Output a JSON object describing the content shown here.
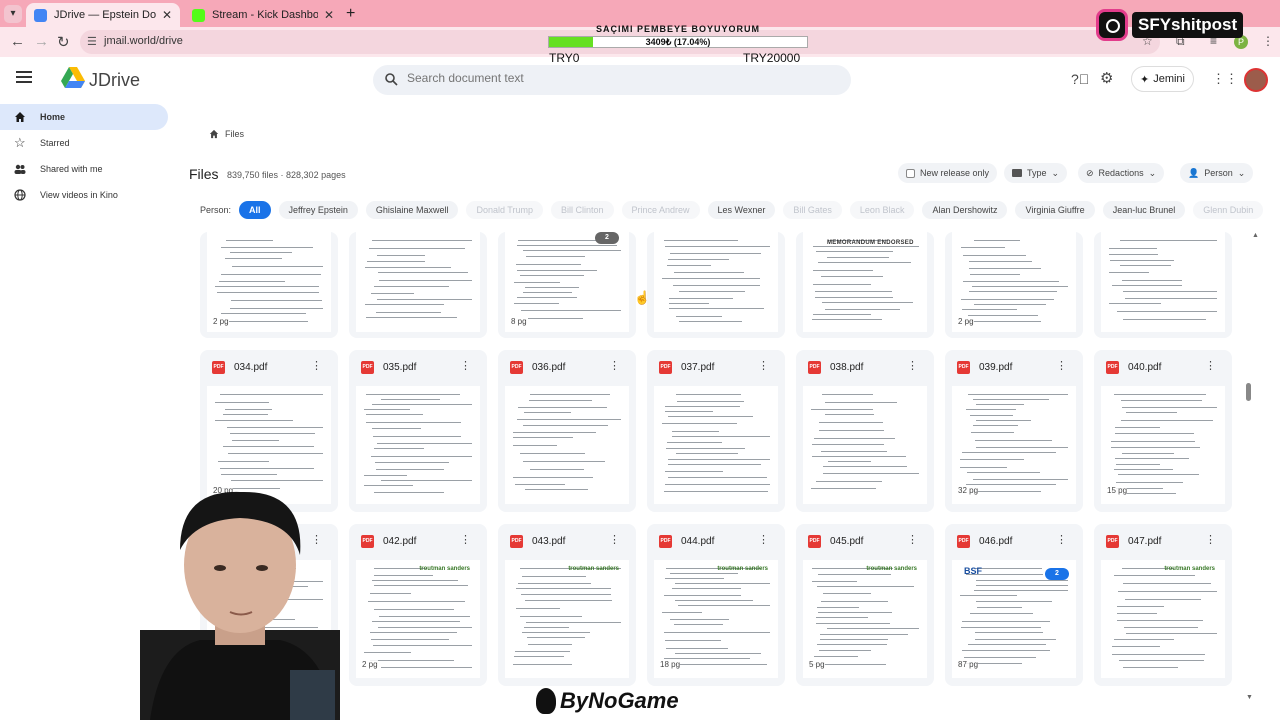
{
  "browser": {
    "tabs": [
      {
        "title": "JDrive — Epstein Document Ar",
        "active": true,
        "favicon_color": "#4285f4"
      },
      {
        "title": "Stream - Kick Dashboard",
        "active": false,
        "favicon_color": "#53fc18"
      }
    ],
    "url": "jmail.world/drive",
    "profile_initial": "P"
  },
  "overlay": {
    "goal_title": "SAÇIMI PEMBEYE BOYUYORUM",
    "goal_progress_text": "3409₺ (17.04%)",
    "goal_fraction": 0.1704,
    "goal_min": "TRY0",
    "goal_max": "TRY20000",
    "instagram_handle": "SFYshitpost",
    "watermark": "ByNoGame"
  },
  "app": {
    "name": "JDrive",
    "search_placeholder": "Search document text",
    "assistant_label": "Jemini",
    "sidebar": [
      {
        "label": "Home",
        "icon": "home-icon",
        "active": true
      },
      {
        "label": "Starred",
        "icon": "star-icon",
        "active": false
      },
      {
        "label": "Shared with me",
        "icon": "people-icon",
        "active": false
      },
      {
        "label": "View videos in Kino",
        "icon": "globe-icon",
        "active": false
      }
    ],
    "breadcrumb": "Files",
    "files_title": "Files",
    "files_meta": "839,750 files · 828,302 pages",
    "filters": {
      "new_release": "New release only",
      "type": "Type",
      "redactions": "Redactions",
      "person": "Person"
    },
    "person_label": "Person:",
    "person_chips": [
      {
        "label": "All",
        "state": "selected"
      },
      {
        "label": "Jeffrey Epstein",
        "state": "normal"
      },
      {
        "label": "Ghislaine Maxwell",
        "state": "normal"
      },
      {
        "label": "Donald Trump",
        "state": "dim"
      },
      {
        "label": "Bill Clinton",
        "state": "dim"
      },
      {
        "label": "Prince Andrew",
        "state": "dim"
      },
      {
        "label": "Les Wexner",
        "state": "normal"
      },
      {
        "label": "Bill Gates",
        "state": "dim"
      },
      {
        "label": "Leon Black",
        "state": "dim"
      },
      {
        "label": "Alan Dershowitz",
        "state": "normal"
      },
      {
        "label": "Virginia Giuffre",
        "state": "normal"
      },
      {
        "label": "Jean-luc Brunel",
        "state": "normal"
      },
      {
        "label": "Glenn Dubin",
        "state": "dim"
      }
    ],
    "row1": [
      {
        "pages": "2 pg"
      },
      {
        "pages": ""
      },
      {
        "pages": "8 pg",
        "badge": "2"
      },
      {
        "pages": ""
      },
      {
        "pages": "",
        "memo": "MEMORANDUM ENDORSED"
      },
      {
        "pages": "2 pg"
      },
      {
        "pages": ""
      }
    ],
    "row2": [
      {
        "name": "034.pdf",
        "pages": "20 pg"
      },
      {
        "name": "035.pdf",
        "pages": ""
      },
      {
        "name": "036.pdf",
        "pages": ""
      },
      {
        "name": "037.pdf",
        "pages": ""
      },
      {
        "name": "038.pdf",
        "pages": ""
      },
      {
        "name": "039.pdf",
        "pages": "32 pg"
      },
      {
        "name": "040.pdf",
        "pages": "15 pg"
      }
    ],
    "row3": [
      {
        "name": "",
        "pages": ""
      },
      {
        "name": "042.pdf",
        "pages": "2 pg",
        "brand": "troutman sanders"
      },
      {
        "name": "043.pdf",
        "pages": "",
        "brand": "troutman sanders"
      },
      {
        "name": "044.pdf",
        "pages": "18 pg",
        "brand": "troutman sanders"
      },
      {
        "name": "045.pdf",
        "pages": "5 pg",
        "brand": "troutman sanders"
      },
      {
        "name": "046.pdf",
        "pages": "87 pg",
        "brand2": "BSF",
        "badge": "2"
      },
      {
        "name": "047.pdf",
        "pages": "",
        "brand": "troutman sanders"
      }
    ],
    "file_type_label": "PDF"
  }
}
